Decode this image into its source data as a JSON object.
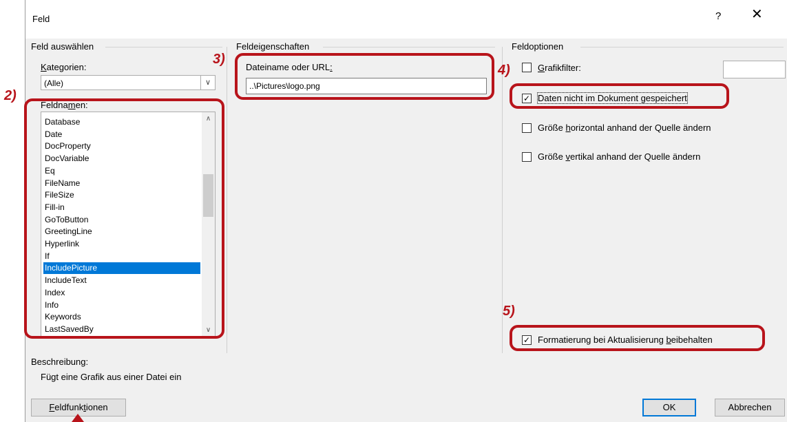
{
  "dialog": {
    "title": "Feld",
    "help": "?",
    "close": "✕"
  },
  "field_select": {
    "group_title": "Feld auswählen",
    "categories_label": "Kategorien:",
    "categories_value": "(Alle)",
    "fieldnames_label": "Feldnamen:",
    "fieldnames": [
      "Database",
      "Date",
      "DocProperty",
      "DocVariable",
      "Eq",
      "FileName",
      "FileSize",
      "Fill-in",
      "GoToButton",
      "GreetingLine",
      "Hyperlink",
      "If",
      "IncludePicture",
      "IncludeText",
      "Index",
      "Info",
      "Keywords",
      "LastSavedBy"
    ],
    "selected": "IncludePicture",
    "description_label": "Beschreibung:",
    "description": "Fügt eine Grafik aus einer Datei ein"
  },
  "field_properties": {
    "group_title": "Feldeigenschaften",
    "filename_label": "Dateiname oder URL:",
    "filename_value": "..\\Pictures\\logo.png"
  },
  "field_options": {
    "group_title": "Feldoptionen",
    "graphic_filter_label": "Grafikfilter:",
    "graphic_filter_checked": false,
    "data_not_stored_label": "Daten nicht im Dokument gespeichert",
    "data_not_stored_checked": true,
    "resize_horizontal_label": "Größe horizontal anhand der Quelle ändern",
    "resize_horizontal_checked": false,
    "resize_vertical_label": "Größe vertikal anhand der Quelle ändern",
    "resize_vertical_checked": false,
    "preserve_format_label": "Formatierung bei Aktualisierung beibehalten",
    "preserve_format_checked": true
  },
  "buttons": {
    "field_codes": "Feldfunktionen",
    "ok": "OK",
    "cancel": "Abbrechen"
  },
  "annotations": {
    "marker_2": "2)",
    "marker_3": "3)",
    "marker_4": "4)",
    "marker_5": "5)",
    "color": "#b8141b"
  }
}
